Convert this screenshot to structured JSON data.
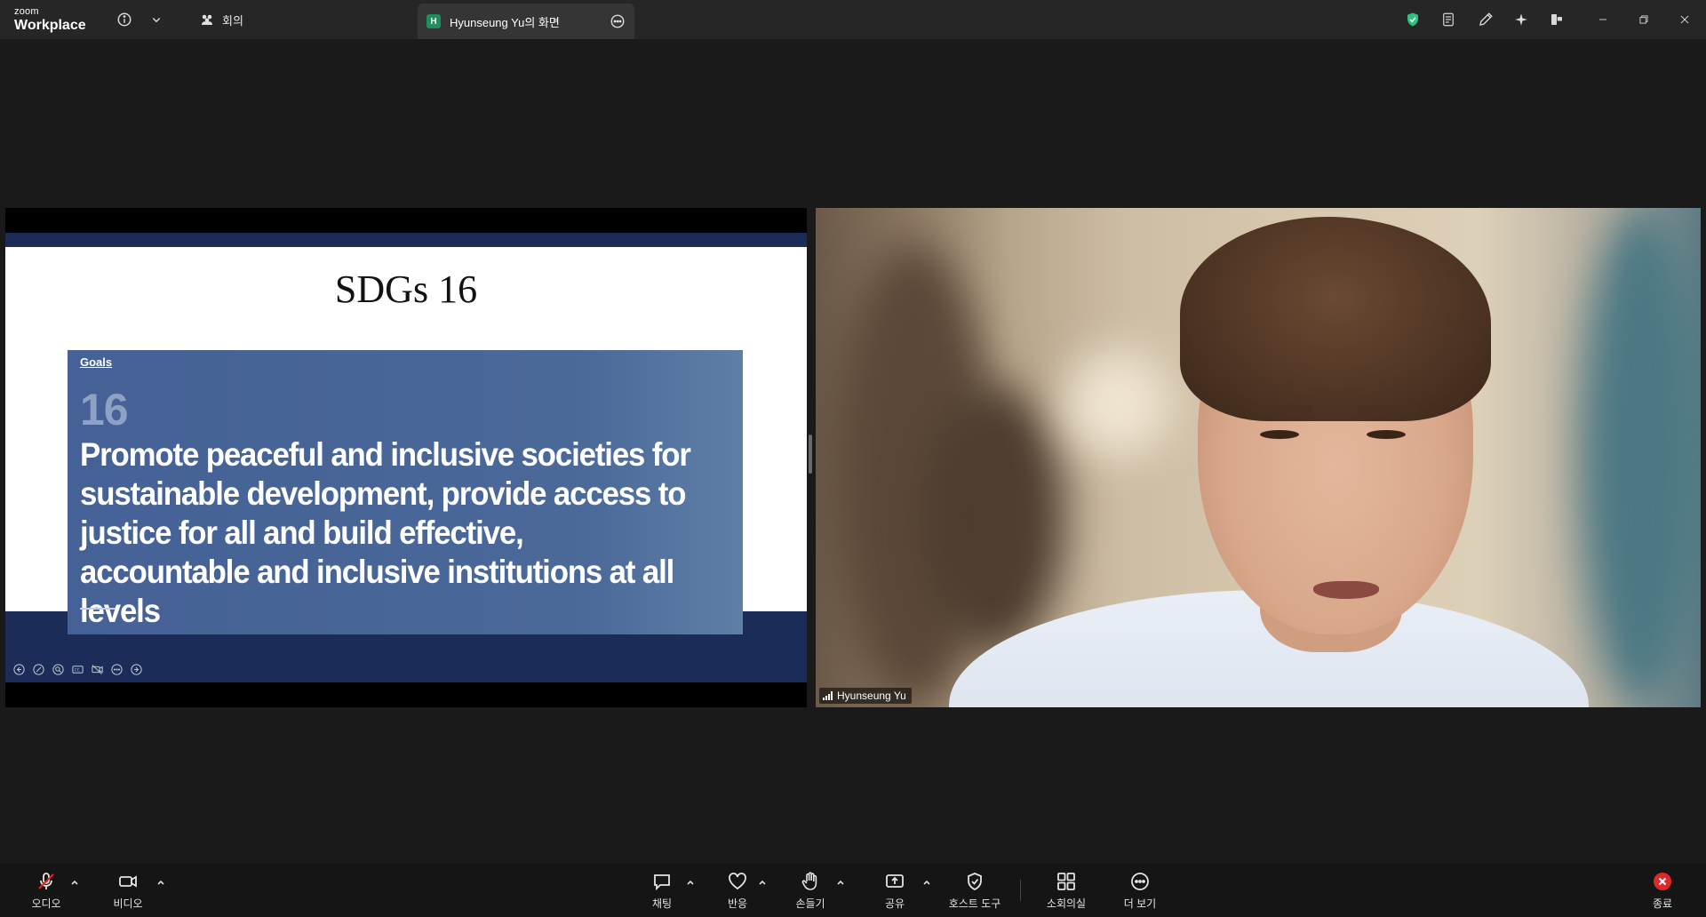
{
  "titlebar": {
    "logo_small": "zoom",
    "logo_big": "Workplace",
    "meeting_tab_label": "회의",
    "share_tab_initial": "H",
    "share_tab_label": "Hyunseung Yu의 화면"
  },
  "slide": {
    "title": "SDGs 16",
    "goals_label": "Goals",
    "goal_number": "16",
    "goal_text": "Promote peaceful and inclusive societies for sustainable development, provide access to justice for all and build effective, accountable and inclusive institutions at all levels"
  },
  "video": {
    "participant_name": "Hyunseung Yu"
  },
  "toolbar": {
    "audio_label": "오디오",
    "video_label": "비디오",
    "chat_label": "채팅",
    "reactions_label": "반응",
    "raise_hand_label": "손들기",
    "share_label": "공유",
    "host_tools_label": "호스트 도구",
    "breakout_label": "소회의실",
    "more_label": "더 보기",
    "end_label": "종료"
  },
  "colors": {
    "security_shield": "#2ec27e",
    "end_red": "#e02828",
    "mic_muted_red": "#e02828",
    "slide_card_blue": "#4a6898",
    "slide_band_navy": "#1c2c58"
  }
}
